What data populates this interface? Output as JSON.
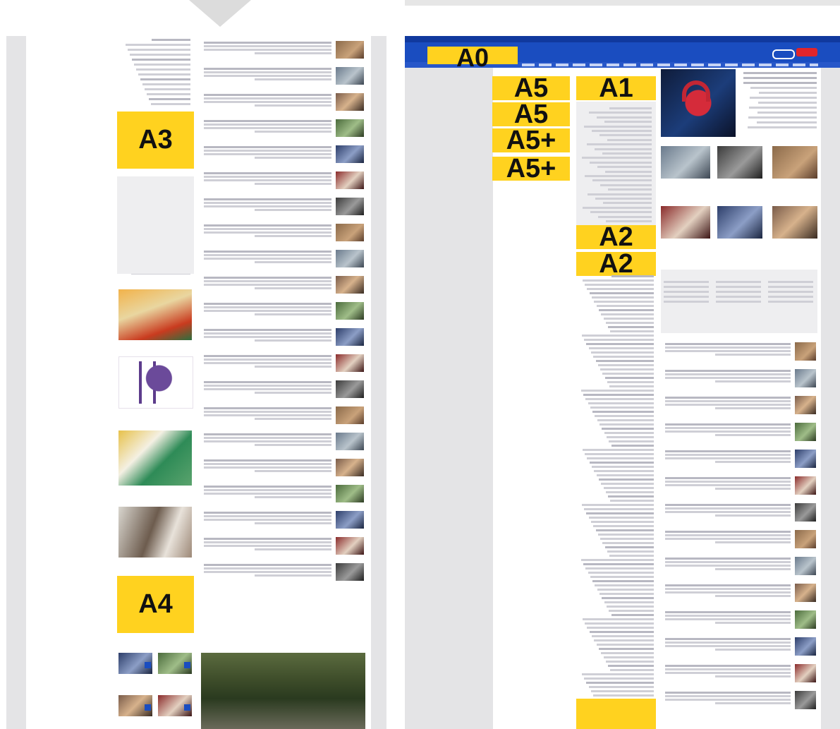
{
  "labels": {
    "a0": "A0",
    "a1": "A1",
    "a2_first": "A2",
    "a2_second": "A2",
    "a3": "A3",
    "a4": "A4",
    "a5_first": "A5",
    "a5_second": "A5",
    "a5plus_first": "A5+",
    "a5plus_second": "A5+"
  },
  "colors": {
    "ad_slot": "#ffd21f",
    "header_blue": "#1a4dc0",
    "panel_gray": "#e4e4e6",
    "brand_red": "#e0252b"
  },
  "icons": {
    "logo": "site-logo-icon",
    "play": "play-icon",
    "down_arrow": "down-arrow-icon"
  }
}
